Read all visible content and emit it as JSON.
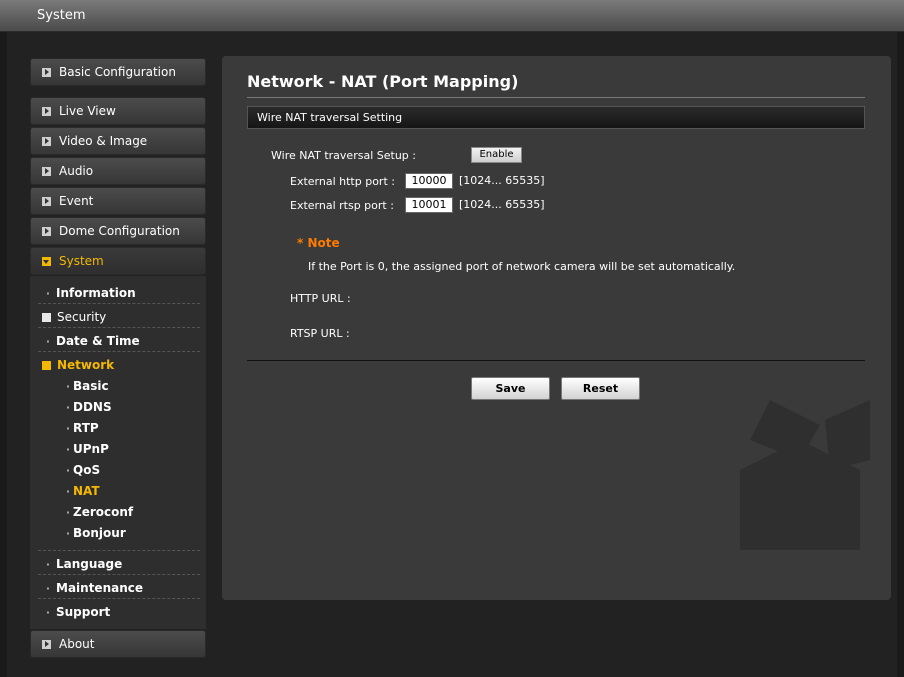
{
  "window": {
    "title": "System"
  },
  "sidebar": {
    "basic_config": "Basic Configuration",
    "live_view": "Live View",
    "video_image": "Video & Image",
    "audio": "Audio",
    "event": "Event",
    "dome_config": "Dome Configuration",
    "system": "System",
    "system_items": {
      "information": "Information",
      "security": "Security",
      "date_time": "Date & Time",
      "network": "Network",
      "network_items": [
        "Basic",
        "DDNS",
        "RTP",
        "UPnP",
        "QoS",
        "NAT",
        "Zeroconf",
        "Bonjour"
      ],
      "language": "Language",
      "maintenance": "Maintenance",
      "support": "Support"
    },
    "about": "About",
    "selected_network_item": "NAT"
  },
  "main": {
    "title": "Network - NAT (Port Mapping)",
    "section": "Wire NAT traversal Setting",
    "setup_label": "Wire NAT traversal Setup :",
    "enable_button": "Enable",
    "http_label": "External http port :",
    "http_value": "10000",
    "http_range": "[1024... 65535]",
    "rtsp_label": "External rtsp port :",
    "rtsp_value": "10001",
    "rtsp_range": "[1024... 65535]",
    "note_title": "* Note",
    "note_text": "If the Port is 0, the assigned port of network camera will be set automatically.",
    "http_url_label": "HTTP URL :",
    "rtsp_url_label": "RTSP URL :",
    "save_button": "Save",
    "reset_button": "Reset"
  },
  "colors": {
    "accent": "#f5b800",
    "note": "#ff7a00"
  }
}
